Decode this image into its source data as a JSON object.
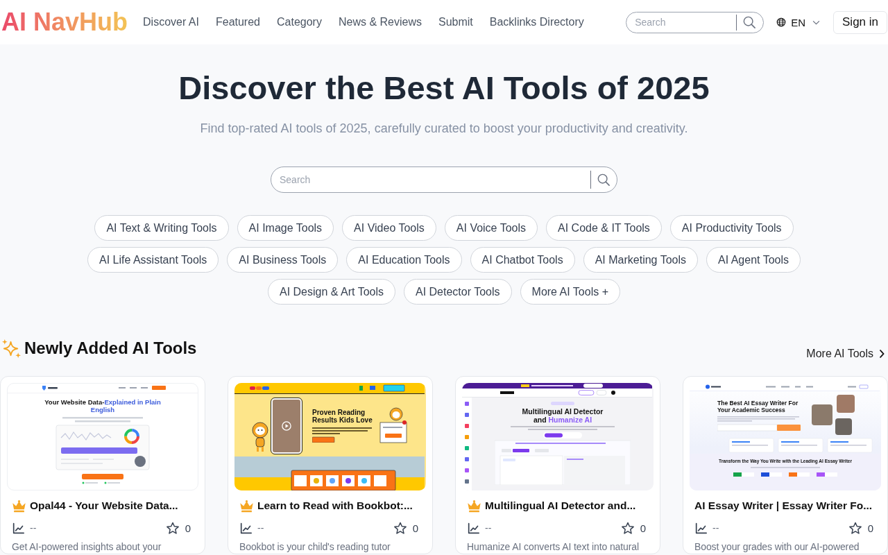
{
  "header": {
    "logo": "AI NavHub",
    "nav": [
      "Discover AI",
      "Featured",
      "Category",
      "News & Reviews",
      "Submit",
      "Backlinks Directory"
    ],
    "search": {
      "placeholder": "Search"
    },
    "language": "EN",
    "sign_in": "Sign in"
  },
  "hero": {
    "title": "Discover the Best AI Tools of 2025",
    "subtitle": "Find top-rated AI tools of 2025, carefully curated to boost your productivity and creativity.",
    "search": {
      "placeholder": "Search"
    },
    "categories": [
      "AI Text & Writing Tools",
      "AI Image Tools",
      "AI Video Tools",
      "AI Voice Tools",
      "AI Code & IT Tools",
      "AI Productivity Tools",
      "AI Life Assistant Tools",
      "AI Business Tools",
      "AI Education Tools",
      "AI Chatbot Tools",
      "AI Marketing Tools",
      "AI Agent Tools",
      "AI Design & Art Tools",
      "AI Detector Tools",
      "More AI Tools +"
    ]
  },
  "newly_added": {
    "title": "Newly Added AI Tools",
    "more_link": "More AI Tools",
    "cards": [
      {
        "title": "Opal44 - Your Website Data...",
        "featured": true,
        "trend": "--",
        "favorites": "0",
        "description": "Get AI-powered insights about your",
        "thumbnail": {
          "kind": "analytics",
          "headline": "Your Website Data-",
          "headline_accent": "Explained in Plain English"
        }
      },
      {
        "title": "Learn to Read with Bookbot:...",
        "featured": true,
        "trend": "--",
        "favorites": "0",
        "description": "Bookbot is your child's reading tutor",
        "thumbnail": {
          "kind": "illustration",
          "headline": "Proven Reading Results Kids Love"
        }
      },
      {
        "title": "Multilingual AI Detector and...",
        "featured": true,
        "trend": "--",
        "favorites": "0",
        "description": "Humanize AI converts AI text into natural",
        "thumbnail": {
          "kind": "app",
          "headline": "Multilingual AI Detector and ",
          "headline_accent": "Humanize AI"
        }
      },
      {
        "title": "AI Essay Writer | Essay Writer Fo...",
        "featured": false,
        "trend": "--",
        "favorites": "0",
        "description": "Boost your grades with our AI-powered",
        "thumbnail": {
          "kind": "landing",
          "headline": "The Best AI Essay Writer For Your Academic Success",
          "subheadline": "Transform the Way You Write with the Leading AI Essay Writer"
        }
      }
    ]
  }
}
